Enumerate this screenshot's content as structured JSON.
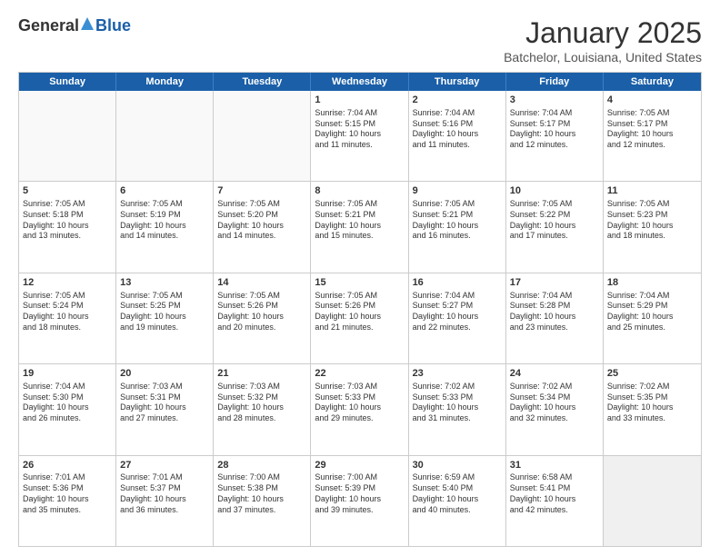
{
  "logo": {
    "general": "General",
    "blue": "Blue"
  },
  "title": "January 2025",
  "subtitle": "Batchelor, Louisiana, United States",
  "header": {
    "days": [
      "Sunday",
      "Monday",
      "Tuesday",
      "Wednesday",
      "Thursday",
      "Friday",
      "Saturday"
    ]
  },
  "weeks": [
    [
      {
        "day": "",
        "content": ""
      },
      {
        "day": "",
        "content": ""
      },
      {
        "day": "",
        "content": ""
      },
      {
        "day": "1",
        "content": "Sunrise: 7:04 AM\nSunset: 5:15 PM\nDaylight: 10 hours\nand 11 minutes."
      },
      {
        "day": "2",
        "content": "Sunrise: 7:04 AM\nSunset: 5:16 PM\nDaylight: 10 hours\nand 11 minutes."
      },
      {
        "day": "3",
        "content": "Sunrise: 7:04 AM\nSunset: 5:17 PM\nDaylight: 10 hours\nand 12 minutes."
      },
      {
        "day": "4",
        "content": "Sunrise: 7:05 AM\nSunset: 5:17 PM\nDaylight: 10 hours\nand 12 minutes."
      }
    ],
    [
      {
        "day": "5",
        "content": "Sunrise: 7:05 AM\nSunset: 5:18 PM\nDaylight: 10 hours\nand 13 minutes."
      },
      {
        "day": "6",
        "content": "Sunrise: 7:05 AM\nSunset: 5:19 PM\nDaylight: 10 hours\nand 14 minutes."
      },
      {
        "day": "7",
        "content": "Sunrise: 7:05 AM\nSunset: 5:20 PM\nDaylight: 10 hours\nand 14 minutes."
      },
      {
        "day": "8",
        "content": "Sunrise: 7:05 AM\nSunset: 5:21 PM\nDaylight: 10 hours\nand 15 minutes."
      },
      {
        "day": "9",
        "content": "Sunrise: 7:05 AM\nSunset: 5:21 PM\nDaylight: 10 hours\nand 16 minutes."
      },
      {
        "day": "10",
        "content": "Sunrise: 7:05 AM\nSunset: 5:22 PM\nDaylight: 10 hours\nand 17 minutes."
      },
      {
        "day": "11",
        "content": "Sunrise: 7:05 AM\nSunset: 5:23 PM\nDaylight: 10 hours\nand 18 minutes."
      }
    ],
    [
      {
        "day": "12",
        "content": "Sunrise: 7:05 AM\nSunset: 5:24 PM\nDaylight: 10 hours\nand 18 minutes."
      },
      {
        "day": "13",
        "content": "Sunrise: 7:05 AM\nSunset: 5:25 PM\nDaylight: 10 hours\nand 19 minutes."
      },
      {
        "day": "14",
        "content": "Sunrise: 7:05 AM\nSunset: 5:26 PM\nDaylight: 10 hours\nand 20 minutes."
      },
      {
        "day": "15",
        "content": "Sunrise: 7:05 AM\nSunset: 5:26 PM\nDaylight: 10 hours\nand 21 minutes."
      },
      {
        "day": "16",
        "content": "Sunrise: 7:04 AM\nSunset: 5:27 PM\nDaylight: 10 hours\nand 22 minutes."
      },
      {
        "day": "17",
        "content": "Sunrise: 7:04 AM\nSunset: 5:28 PM\nDaylight: 10 hours\nand 23 minutes."
      },
      {
        "day": "18",
        "content": "Sunrise: 7:04 AM\nSunset: 5:29 PM\nDaylight: 10 hours\nand 25 minutes."
      }
    ],
    [
      {
        "day": "19",
        "content": "Sunrise: 7:04 AM\nSunset: 5:30 PM\nDaylight: 10 hours\nand 26 minutes."
      },
      {
        "day": "20",
        "content": "Sunrise: 7:03 AM\nSunset: 5:31 PM\nDaylight: 10 hours\nand 27 minutes."
      },
      {
        "day": "21",
        "content": "Sunrise: 7:03 AM\nSunset: 5:32 PM\nDaylight: 10 hours\nand 28 minutes."
      },
      {
        "day": "22",
        "content": "Sunrise: 7:03 AM\nSunset: 5:33 PM\nDaylight: 10 hours\nand 29 minutes."
      },
      {
        "day": "23",
        "content": "Sunrise: 7:02 AM\nSunset: 5:33 PM\nDaylight: 10 hours\nand 31 minutes."
      },
      {
        "day": "24",
        "content": "Sunrise: 7:02 AM\nSunset: 5:34 PM\nDaylight: 10 hours\nand 32 minutes."
      },
      {
        "day": "25",
        "content": "Sunrise: 7:02 AM\nSunset: 5:35 PM\nDaylight: 10 hours\nand 33 minutes."
      }
    ],
    [
      {
        "day": "26",
        "content": "Sunrise: 7:01 AM\nSunset: 5:36 PM\nDaylight: 10 hours\nand 35 minutes."
      },
      {
        "day": "27",
        "content": "Sunrise: 7:01 AM\nSunset: 5:37 PM\nDaylight: 10 hours\nand 36 minutes."
      },
      {
        "day": "28",
        "content": "Sunrise: 7:00 AM\nSunset: 5:38 PM\nDaylight: 10 hours\nand 37 minutes."
      },
      {
        "day": "29",
        "content": "Sunrise: 7:00 AM\nSunset: 5:39 PM\nDaylight: 10 hours\nand 39 minutes."
      },
      {
        "day": "30",
        "content": "Sunrise: 6:59 AM\nSunset: 5:40 PM\nDaylight: 10 hours\nand 40 minutes."
      },
      {
        "day": "31",
        "content": "Sunrise: 6:58 AM\nSunset: 5:41 PM\nDaylight: 10 hours\nand 42 minutes."
      },
      {
        "day": "",
        "content": ""
      }
    ]
  ]
}
